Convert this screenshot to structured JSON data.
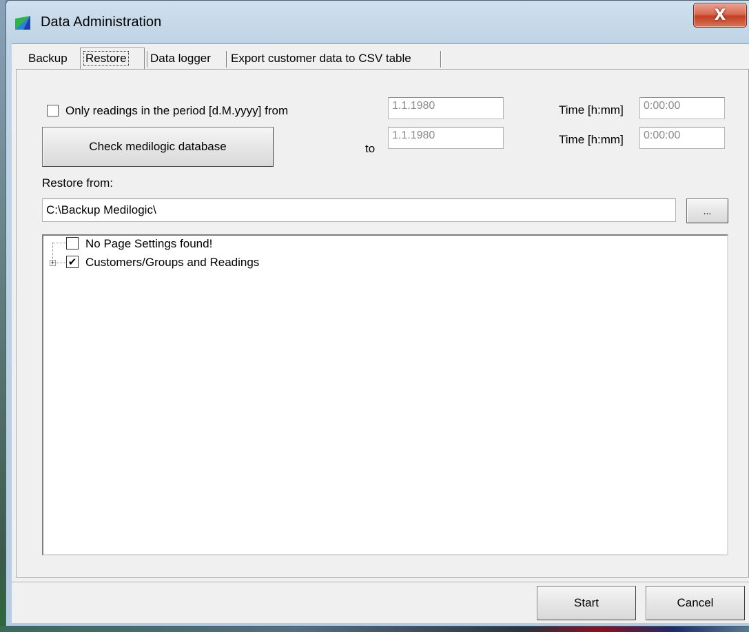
{
  "window": {
    "title": "Data Administration",
    "close_glyph": "X"
  },
  "tabs": [
    {
      "label": "Backup"
    },
    {
      "label": "Restore",
      "active": true
    },
    {
      "label": "Data logger"
    },
    {
      "label": "Export customer data to CSV table"
    }
  ],
  "period": {
    "checkbox_label": "Only readings in the period [d.M.yyyy] from",
    "checked": false,
    "from_date": "1.1.1980",
    "to_label": "to",
    "to_date": "1.1.1980",
    "time_label_from": "Time [h:mm]",
    "from_time": "0:00:00",
    "time_label_to": "Time [h:mm]",
    "to_time": "0:00:00"
  },
  "check_db_button": "Check medilogic database",
  "restore": {
    "label": "Restore from:",
    "path": "C:\\Backup Medilogic\\",
    "browse_label": "..."
  },
  "tree": {
    "items": [
      {
        "label": "No Page Settings found!",
        "checked": false,
        "expandable": false
      },
      {
        "label": "Customers/Groups and Readings",
        "checked": true,
        "expandable": true,
        "check_glyph": "✔",
        "expander_glyph": "+"
      }
    ]
  },
  "footer": {
    "start_label": "Start",
    "cancel_label": "Cancel"
  },
  "colors": {
    "title_bar": "#bfd4e6",
    "close_button": "#c43f24",
    "dialog_bg": "#f0f0f0"
  }
}
